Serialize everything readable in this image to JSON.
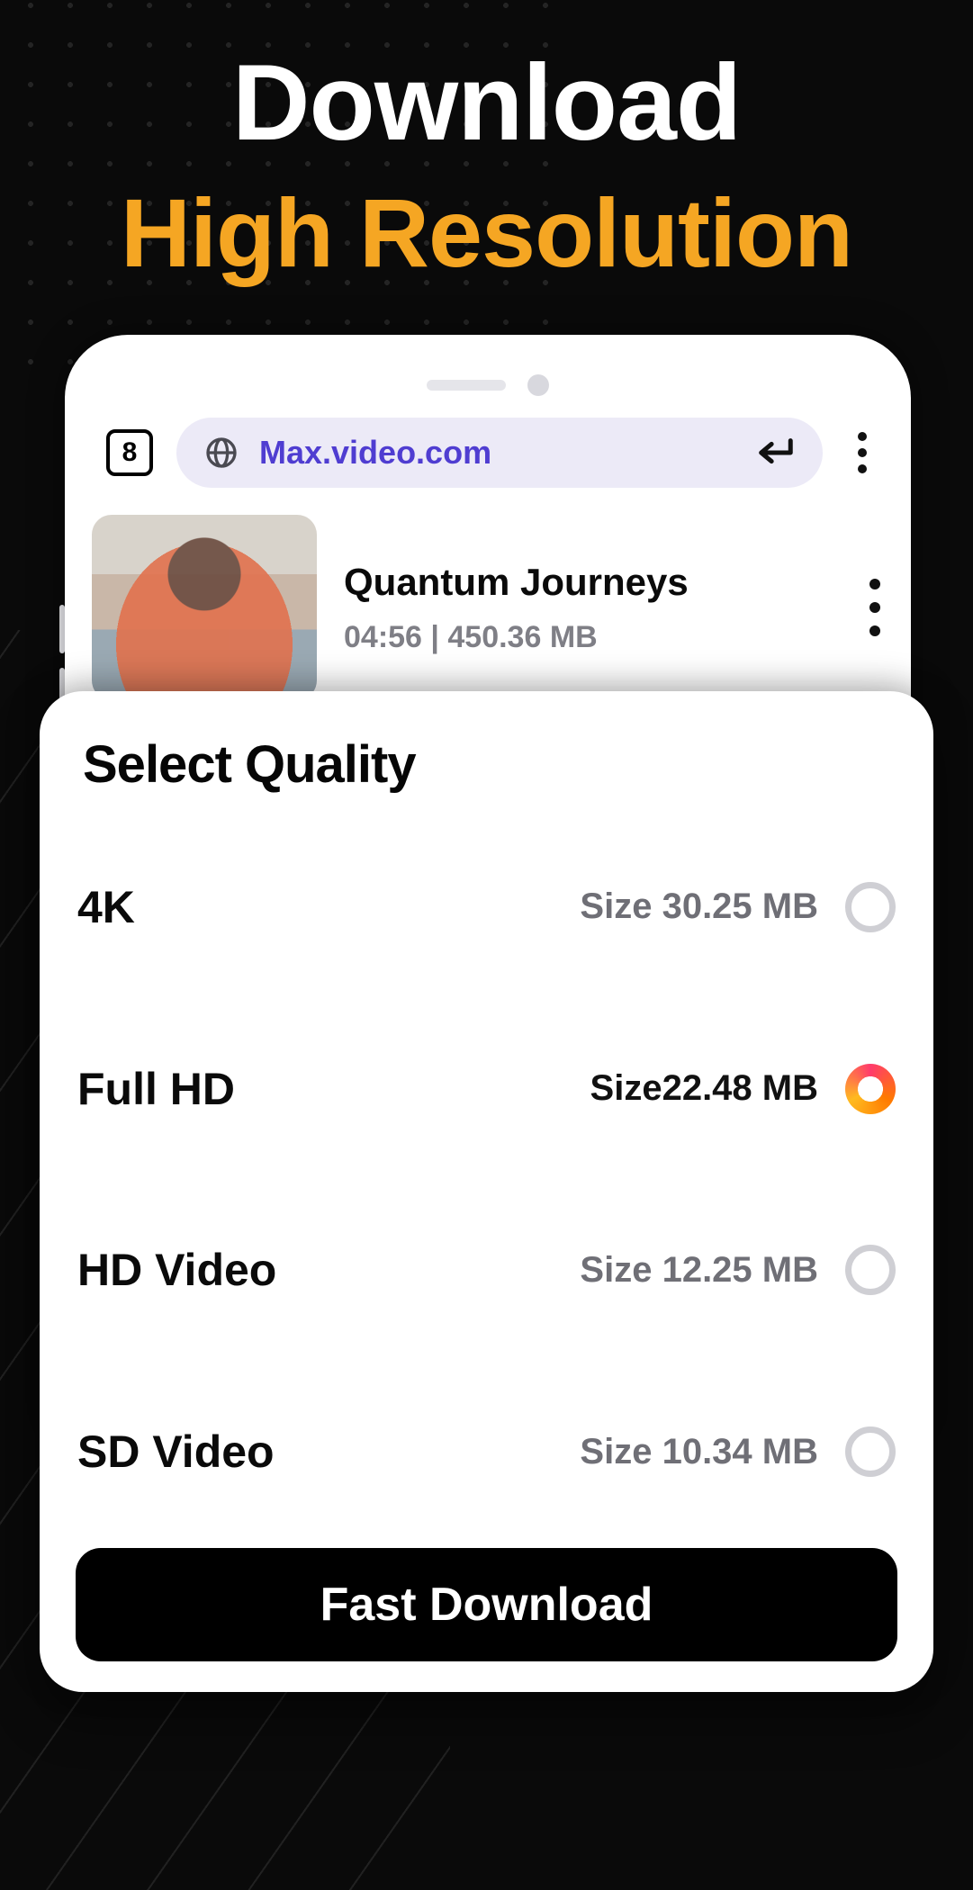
{
  "hero": {
    "line1": "Download",
    "line2": "High Resolution"
  },
  "browser": {
    "tab_count": "8",
    "url": "Max.video.com"
  },
  "video": {
    "title": "Quantum Journeys",
    "duration": "04:56",
    "separator": " | ",
    "size": "450.36 MB"
  },
  "sheet": {
    "title": "Select Quality",
    "options": [
      {
        "label": "4K",
        "size": "Size 30.25 MB",
        "selected": false
      },
      {
        "label": "Full HD",
        "size": "Size22.48 MB",
        "selected": true
      },
      {
        "label": "HD Video",
        "size": "Size 12.25 MB",
        "selected": false
      },
      {
        "label": "SD Video",
        "size": "Size 10.34 MB",
        "selected": false
      }
    ],
    "cta": "Fast Download"
  }
}
